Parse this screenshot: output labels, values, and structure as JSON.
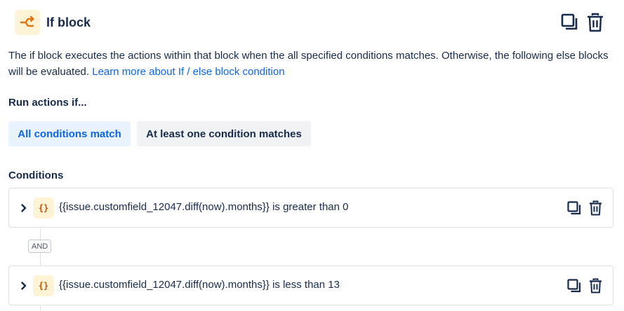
{
  "header": {
    "title": "If block",
    "icon": "branch-icon",
    "accent_color": "#e2730f"
  },
  "description": {
    "text": "The if block executes the actions within that block when the all specified conditions matches. Otherwise, the following else blocks will be evaluated. ",
    "link_label": "Learn more about If / else block condition"
  },
  "run_actions": {
    "label": "Run actions if...",
    "options": [
      "All conditions match",
      "At least one condition matches"
    ],
    "selected": "All conditions match"
  },
  "conditions": {
    "label": "Conditions",
    "connector_label": "AND",
    "items": [
      {
        "icon_label": "{}",
        "text": "{{issue.customfield_12047.diff(now).months}} is greater than 0"
      },
      {
        "icon_label": "{}",
        "text": "{{issue.customfield_12047.diff(now).months}} is less than 13"
      }
    ]
  }
}
